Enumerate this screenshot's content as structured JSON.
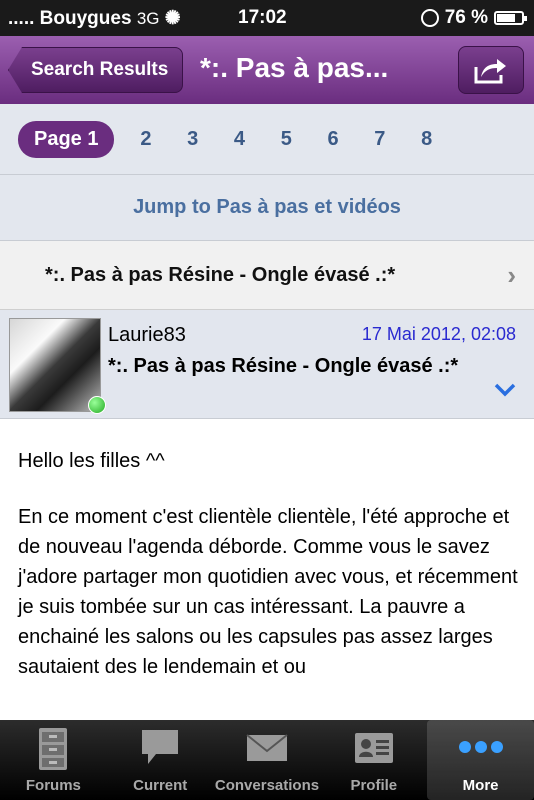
{
  "status_bar": {
    "carrier": "..... Bouygues",
    "network": "3G",
    "time": "17:02",
    "battery": "76 %",
    "battery_level": 0.76
  },
  "nav": {
    "back_label": "Search Results",
    "title": "*:. Pas à pas..."
  },
  "pager": {
    "current": "Page 1",
    "pages": [
      "2",
      "3",
      "4",
      "5",
      "6",
      "7",
      "8"
    ]
  },
  "jump_link": "Jump to Pas à pas et vidéos",
  "thread_title": "*:. Pas à pas Résine - Ongle évasé .:*",
  "post": {
    "author": "Laurie83",
    "date": "17 Mai 2012, 02:08",
    "title": "*:. Pas à pas Résine - Ongle évasé .:*",
    "paragraphs": [
      "Hello les filles ^^",
      "En ce moment c'est clientèle clientèle, l'été approche et de nouveau l'agenda déborde. Comme vous le savez j'adore partager mon quotidien avec vous, et récemment je suis tombée sur un cas intéressant. La pauvre a enchainé les salons ou les capsules pas assez larges sautaient des le lendemain et ou"
    ]
  },
  "tabs": [
    {
      "label": "Forums",
      "icon": "cabinet-icon"
    },
    {
      "label": "Current",
      "icon": "speech-bubble-icon"
    },
    {
      "label": "Conversations",
      "icon": "envelope-icon"
    },
    {
      "label": "Profile",
      "icon": "id-card-icon"
    },
    {
      "label": "More",
      "icon": "more-dots-icon"
    }
  ],
  "colors": {
    "accent": "#6a2d7f",
    "link": "#4a6fa0",
    "date": "#2a2ad0",
    "active_tab_dots": "#3aa0ff"
  }
}
